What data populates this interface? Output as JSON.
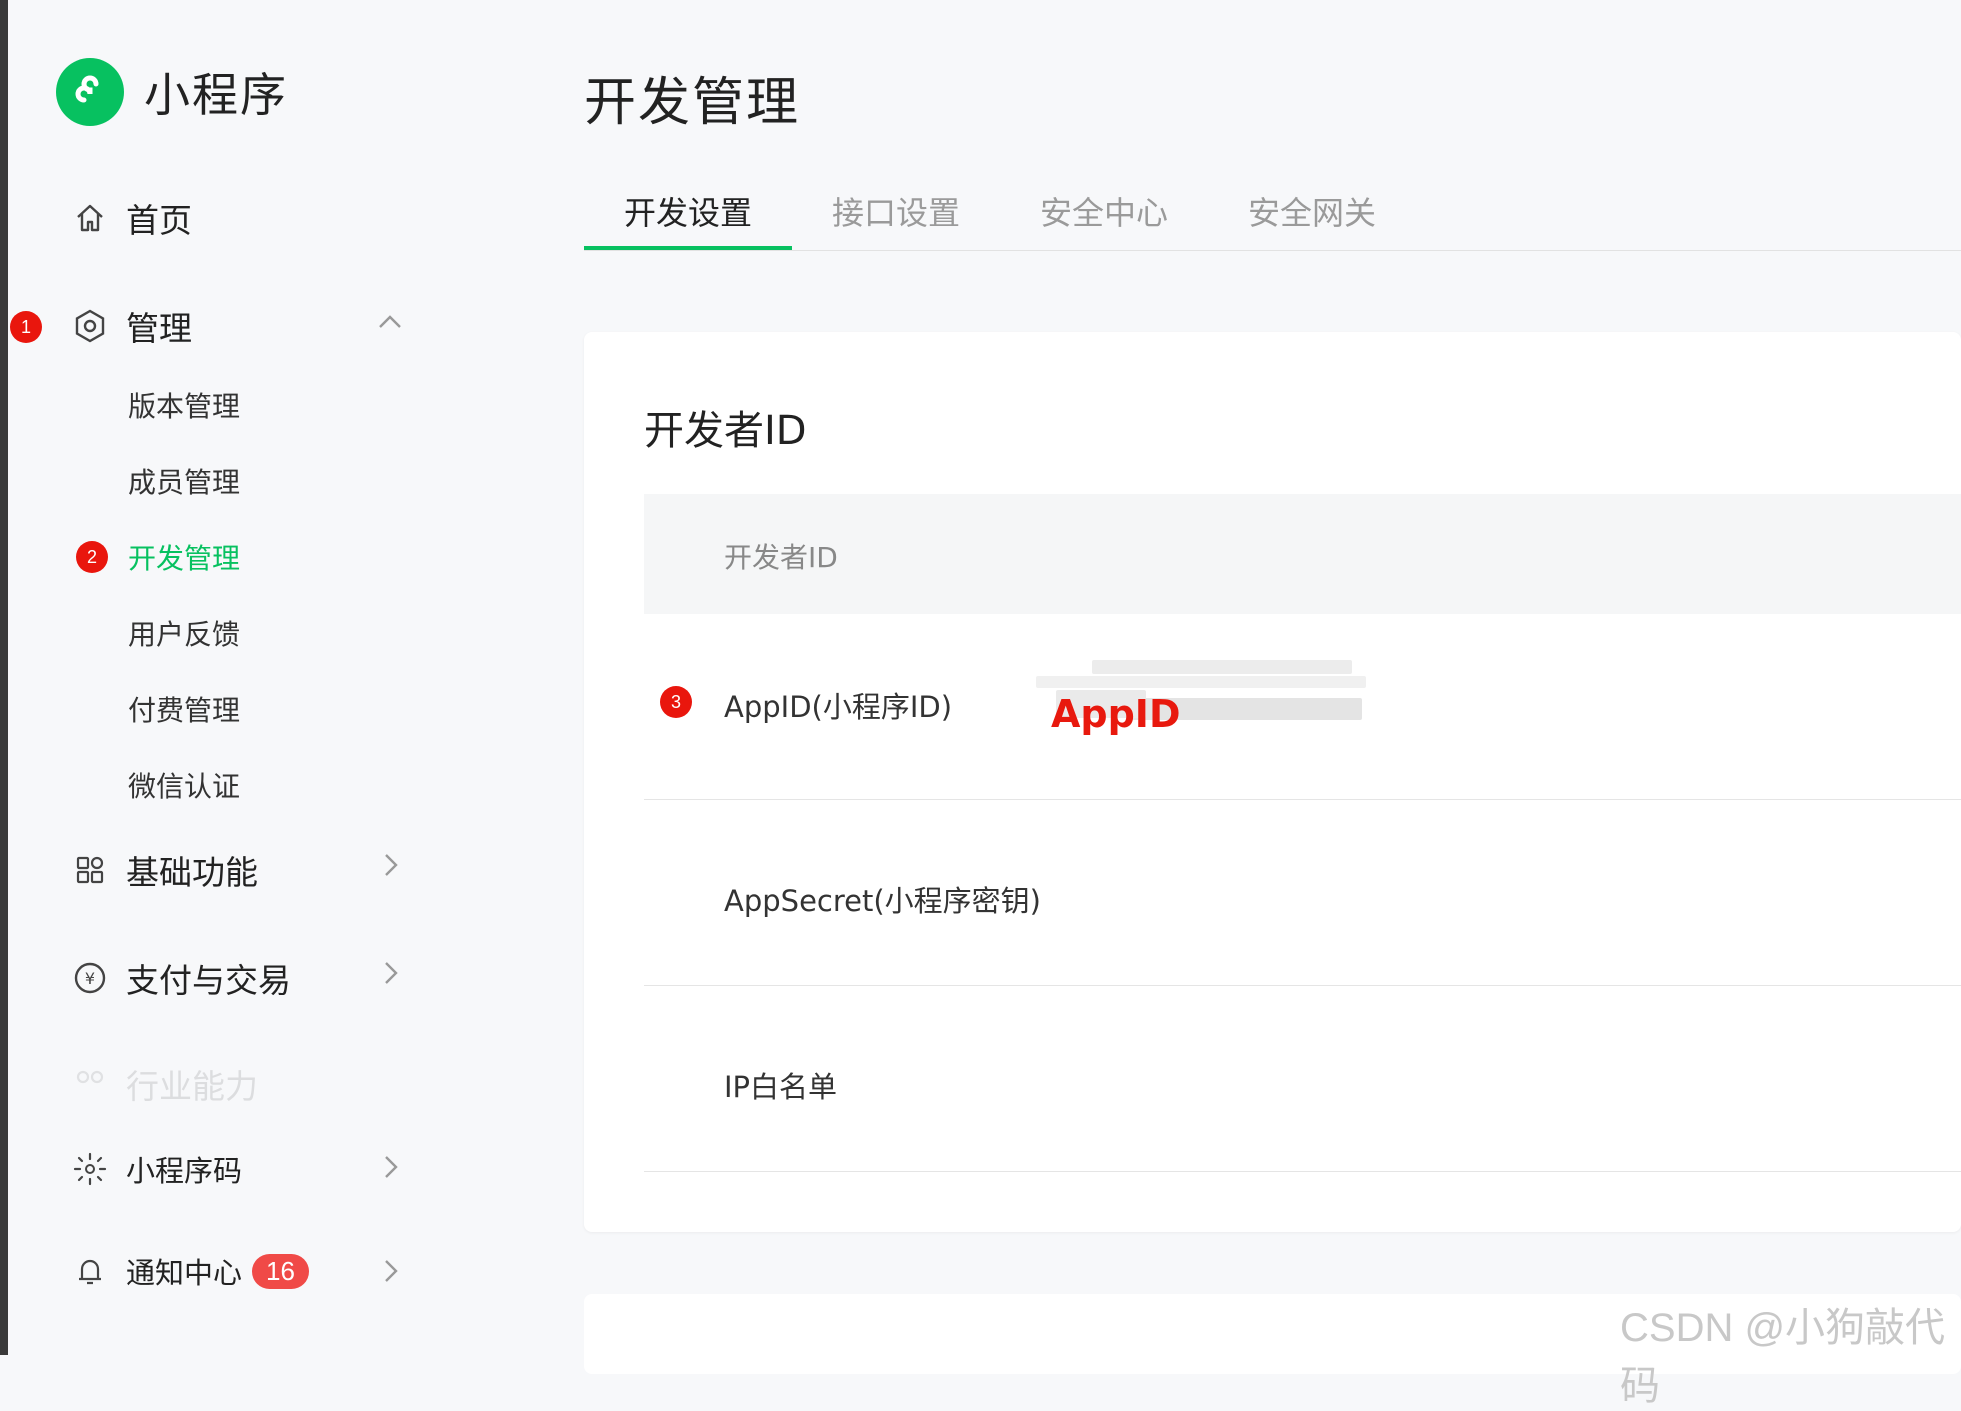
{
  "app": {
    "name": "小程序"
  },
  "sidebar": {
    "home": "首页",
    "manage": {
      "label": "管理",
      "marker": "1"
    },
    "sub_items": [
      {
        "label": "版本管理"
      },
      {
        "label": "成员管理"
      },
      {
        "label": "开发管理",
        "marker": "2",
        "active": true
      },
      {
        "label": "用户反馈"
      },
      {
        "label": "付费管理"
      },
      {
        "label": "微信认证"
      }
    ],
    "basic": "基础功能",
    "payment": "支付与交易",
    "industry": "行业能力",
    "qrcode": "小程序码",
    "notify": {
      "label": "通知中心",
      "count": "16"
    }
  },
  "main": {
    "title": "开发管理",
    "tabs": [
      "开发设置",
      "接口设置",
      "安全中心",
      "安全网关"
    ],
    "card": {
      "title": "开发者ID",
      "header": "开发者ID",
      "rows": [
        {
          "label": "AppID(小程序ID)",
          "marker": "3",
          "value_overlay": "AppID"
        },
        {
          "label": "AppSecret(小程序密钥)"
        },
        {
          "label": "IP白名单"
        }
      ]
    }
  },
  "watermark": "CSDN @小狗敲代码",
  "colors": {
    "brand": "#07c160",
    "marker": "#e9160d",
    "annotation": "#e8190e"
  }
}
